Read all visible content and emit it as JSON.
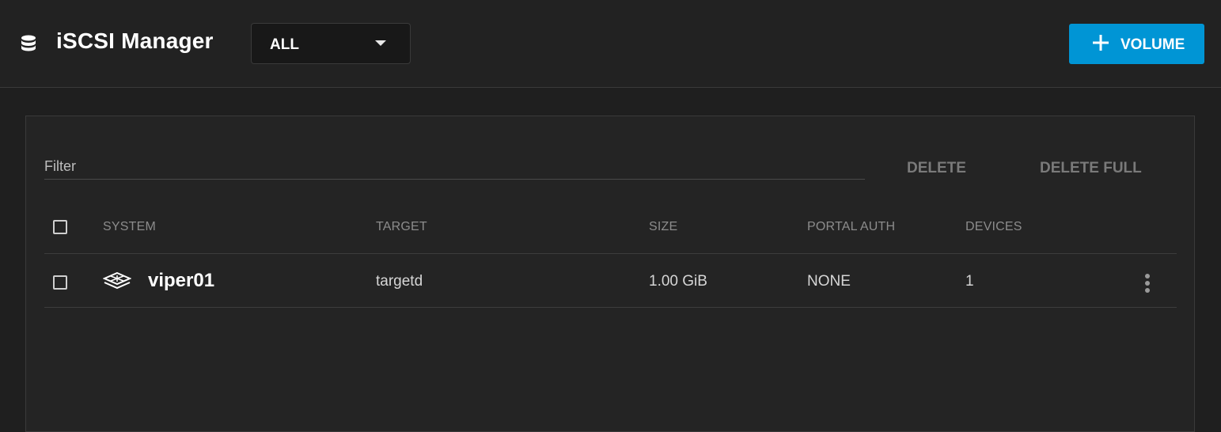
{
  "header": {
    "title": "iSCSI Manager",
    "icon": "database-icon",
    "filter_select": {
      "value": "ALL"
    },
    "add_button": {
      "label": "VOLUME",
      "icon": "plus-icon",
      "color": "#0095d5"
    }
  },
  "toolbar": {
    "filter_placeholder": "Filter",
    "delete_label": "DELETE",
    "delete_full_label": "DELETE FULL"
  },
  "table": {
    "columns": [
      "SYSTEM",
      "TARGET",
      "SIZE",
      "PORTAL AUTH",
      "DEVICES"
    ],
    "rows": [
      {
        "system": "viper01",
        "system_icon": "storage-system-icon",
        "target": "targetd",
        "size": "1.00 GiB",
        "portal_auth": "NONE",
        "devices": "1"
      }
    ]
  }
}
